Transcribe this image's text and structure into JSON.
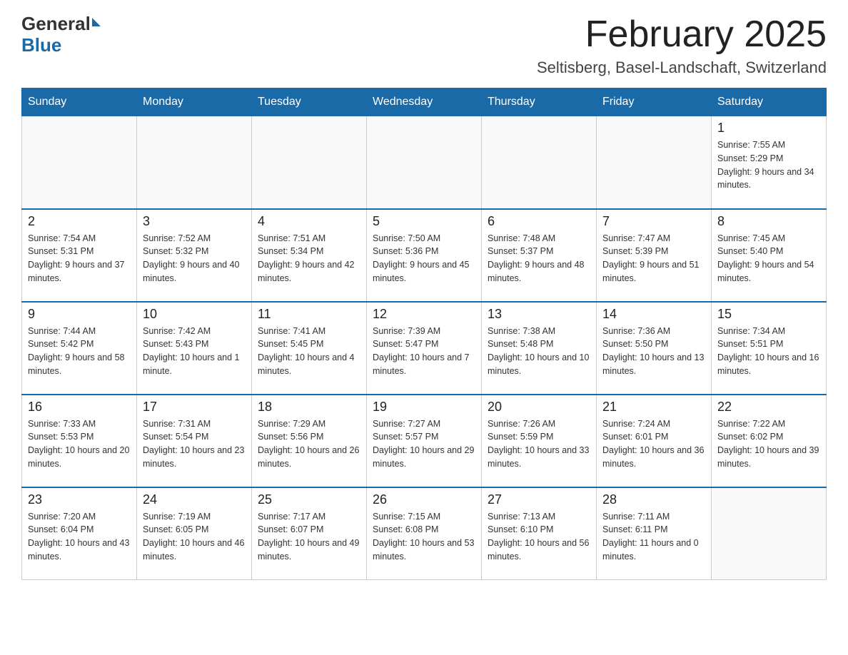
{
  "logo": {
    "general": "General",
    "blue": "Blue"
  },
  "title": "February 2025",
  "location": "Seltisberg, Basel-Landschaft, Switzerland",
  "weekdays": [
    "Sunday",
    "Monday",
    "Tuesday",
    "Wednesday",
    "Thursday",
    "Friday",
    "Saturday"
  ],
  "weeks": [
    [
      {
        "day": "",
        "sunrise": "",
        "sunset": "",
        "daylight": ""
      },
      {
        "day": "",
        "sunrise": "",
        "sunset": "",
        "daylight": ""
      },
      {
        "day": "",
        "sunrise": "",
        "sunset": "",
        "daylight": ""
      },
      {
        "day": "",
        "sunrise": "",
        "sunset": "",
        "daylight": ""
      },
      {
        "day": "",
        "sunrise": "",
        "sunset": "",
        "daylight": ""
      },
      {
        "day": "",
        "sunrise": "",
        "sunset": "",
        "daylight": ""
      },
      {
        "day": "1",
        "sunrise": "Sunrise: 7:55 AM",
        "sunset": "Sunset: 5:29 PM",
        "daylight": "Daylight: 9 hours and 34 minutes."
      }
    ],
    [
      {
        "day": "2",
        "sunrise": "Sunrise: 7:54 AM",
        "sunset": "Sunset: 5:31 PM",
        "daylight": "Daylight: 9 hours and 37 minutes."
      },
      {
        "day": "3",
        "sunrise": "Sunrise: 7:52 AM",
        "sunset": "Sunset: 5:32 PM",
        "daylight": "Daylight: 9 hours and 40 minutes."
      },
      {
        "day": "4",
        "sunrise": "Sunrise: 7:51 AM",
        "sunset": "Sunset: 5:34 PM",
        "daylight": "Daylight: 9 hours and 42 minutes."
      },
      {
        "day": "5",
        "sunrise": "Sunrise: 7:50 AM",
        "sunset": "Sunset: 5:36 PM",
        "daylight": "Daylight: 9 hours and 45 minutes."
      },
      {
        "day": "6",
        "sunrise": "Sunrise: 7:48 AM",
        "sunset": "Sunset: 5:37 PM",
        "daylight": "Daylight: 9 hours and 48 minutes."
      },
      {
        "day": "7",
        "sunrise": "Sunrise: 7:47 AM",
        "sunset": "Sunset: 5:39 PM",
        "daylight": "Daylight: 9 hours and 51 minutes."
      },
      {
        "day": "8",
        "sunrise": "Sunrise: 7:45 AM",
        "sunset": "Sunset: 5:40 PM",
        "daylight": "Daylight: 9 hours and 54 minutes."
      }
    ],
    [
      {
        "day": "9",
        "sunrise": "Sunrise: 7:44 AM",
        "sunset": "Sunset: 5:42 PM",
        "daylight": "Daylight: 9 hours and 58 minutes."
      },
      {
        "day": "10",
        "sunrise": "Sunrise: 7:42 AM",
        "sunset": "Sunset: 5:43 PM",
        "daylight": "Daylight: 10 hours and 1 minute."
      },
      {
        "day": "11",
        "sunrise": "Sunrise: 7:41 AM",
        "sunset": "Sunset: 5:45 PM",
        "daylight": "Daylight: 10 hours and 4 minutes."
      },
      {
        "day": "12",
        "sunrise": "Sunrise: 7:39 AM",
        "sunset": "Sunset: 5:47 PM",
        "daylight": "Daylight: 10 hours and 7 minutes."
      },
      {
        "day": "13",
        "sunrise": "Sunrise: 7:38 AM",
        "sunset": "Sunset: 5:48 PM",
        "daylight": "Daylight: 10 hours and 10 minutes."
      },
      {
        "day": "14",
        "sunrise": "Sunrise: 7:36 AM",
        "sunset": "Sunset: 5:50 PM",
        "daylight": "Daylight: 10 hours and 13 minutes."
      },
      {
        "day": "15",
        "sunrise": "Sunrise: 7:34 AM",
        "sunset": "Sunset: 5:51 PM",
        "daylight": "Daylight: 10 hours and 16 minutes."
      }
    ],
    [
      {
        "day": "16",
        "sunrise": "Sunrise: 7:33 AM",
        "sunset": "Sunset: 5:53 PM",
        "daylight": "Daylight: 10 hours and 20 minutes."
      },
      {
        "day": "17",
        "sunrise": "Sunrise: 7:31 AM",
        "sunset": "Sunset: 5:54 PM",
        "daylight": "Daylight: 10 hours and 23 minutes."
      },
      {
        "day": "18",
        "sunrise": "Sunrise: 7:29 AM",
        "sunset": "Sunset: 5:56 PM",
        "daylight": "Daylight: 10 hours and 26 minutes."
      },
      {
        "day": "19",
        "sunrise": "Sunrise: 7:27 AM",
        "sunset": "Sunset: 5:57 PM",
        "daylight": "Daylight: 10 hours and 29 minutes."
      },
      {
        "day": "20",
        "sunrise": "Sunrise: 7:26 AM",
        "sunset": "Sunset: 5:59 PM",
        "daylight": "Daylight: 10 hours and 33 minutes."
      },
      {
        "day": "21",
        "sunrise": "Sunrise: 7:24 AM",
        "sunset": "Sunset: 6:01 PM",
        "daylight": "Daylight: 10 hours and 36 minutes."
      },
      {
        "day": "22",
        "sunrise": "Sunrise: 7:22 AM",
        "sunset": "Sunset: 6:02 PM",
        "daylight": "Daylight: 10 hours and 39 minutes."
      }
    ],
    [
      {
        "day": "23",
        "sunrise": "Sunrise: 7:20 AM",
        "sunset": "Sunset: 6:04 PM",
        "daylight": "Daylight: 10 hours and 43 minutes."
      },
      {
        "day": "24",
        "sunrise": "Sunrise: 7:19 AM",
        "sunset": "Sunset: 6:05 PM",
        "daylight": "Daylight: 10 hours and 46 minutes."
      },
      {
        "day": "25",
        "sunrise": "Sunrise: 7:17 AM",
        "sunset": "Sunset: 6:07 PM",
        "daylight": "Daylight: 10 hours and 49 minutes."
      },
      {
        "day": "26",
        "sunrise": "Sunrise: 7:15 AM",
        "sunset": "Sunset: 6:08 PM",
        "daylight": "Daylight: 10 hours and 53 minutes."
      },
      {
        "day": "27",
        "sunrise": "Sunrise: 7:13 AM",
        "sunset": "Sunset: 6:10 PM",
        "daylight": "Daylight: 10 hours and 56 minutes."
      },
      {
        "day": "28",
        "sunrise": "Sunrise: 7:11 AM",
        "sunset": "Sunset: 6:11 PM",
        "daylight": "Daylight: 11 hours and 0 minutes."
      },
      {
        "day": "",
        "sunrise": "",
        "sunset": "",
        "daylight": ""
      }
    ]
  ]
}
